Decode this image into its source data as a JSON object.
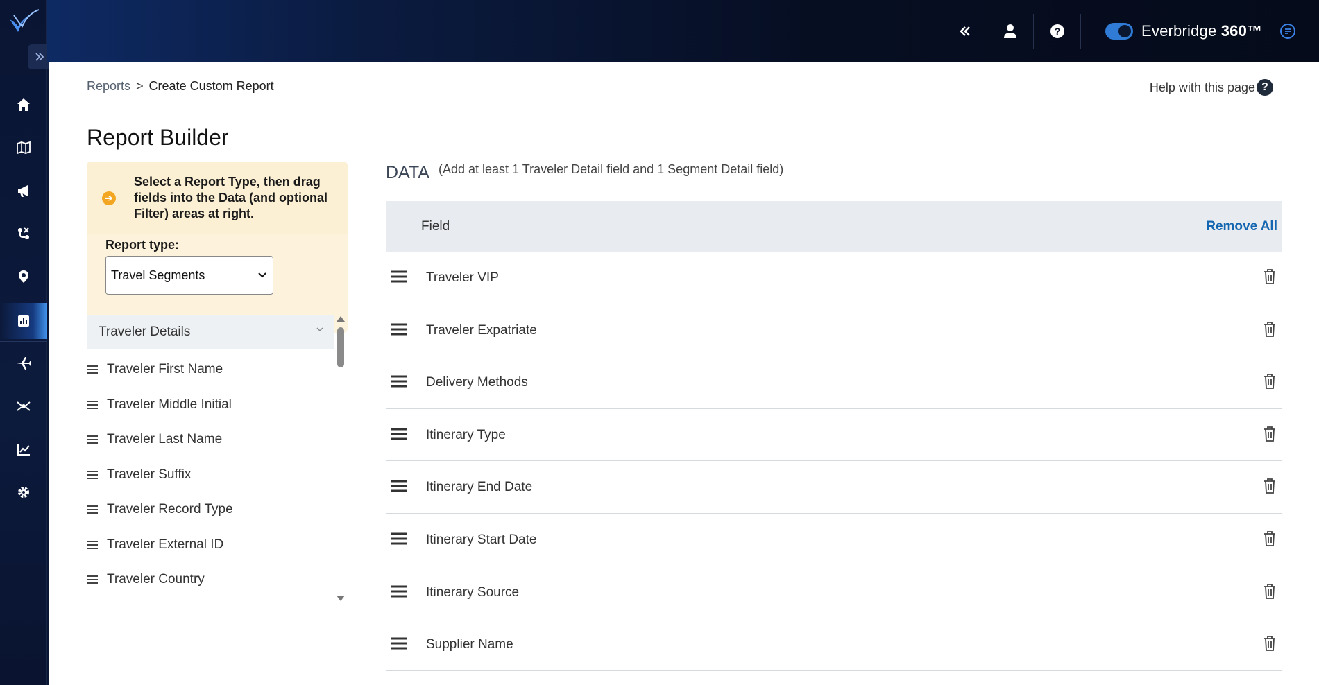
{
  "topbar": {
    "brand_name": "Everbridge",
    "brand_suffix": "360™",
    "icons": [
      "collapse-left-icon",
      "user-icon",
      "help-icon",
      "toggle-switch",
      "chat-icon"
    ]
  },
  "rail": {
    "icons": [
      "home-icon",
      "map-icon",
      "megaphone-icon",
      "route-icon",
      "location-pin-icon",
      "reports-icon",
      "plane-icon",
      "network-icon",
      "analytics-icon",
      "settings-icon"
    ],
    "active": "reports-icon"
  },
  "breadcrumb": {
    "parent": "Reports",
    "separator": ">",
    "current": "Create Custom Report"
  },
  "help_link": "Help with this page",
  "page_title": "Report Builder",
  "info_box": {
    "text": "Select a Report Type, then drag fields into the Data (and optional Filter) areas at right."
  },
  "report_type": {
    "label": "Report type:",
    "selected": "Travel Segments"
  },
  "category": {
    "name": "Traveler Details",
    "fields": [
      "Traveler First Name",
      "Traveler Middle Initial",
      "Traveler Last Name",
      "Traveler Suffix",
      "Traveler Record Type",
      "Traveler External ID",
      "Traveler Country"
    ]
  },
  "data_panel": {
    "title": "DATA",
    "hint": "(Add at least 1 Traveler Detail field and 1 Segment Detail field)",
    "column_header": "Field",
    "remove_all": "Remove All",
    "rows": [
      "Traveler VIP",
      "Traveler Expatriate",
      "Delivery Methods",
      "Itinerary Type",
      "Itinerary End Date",
      "Itinerary Start Date",
      "Itinerary Source",
      "Supplier Name"
    ]
  },
  "colors": {
    "accent": "#1566b0",
    "info_bg": "#fdf3dc",
    "toggle": "#2f7bd6"
  }
}
